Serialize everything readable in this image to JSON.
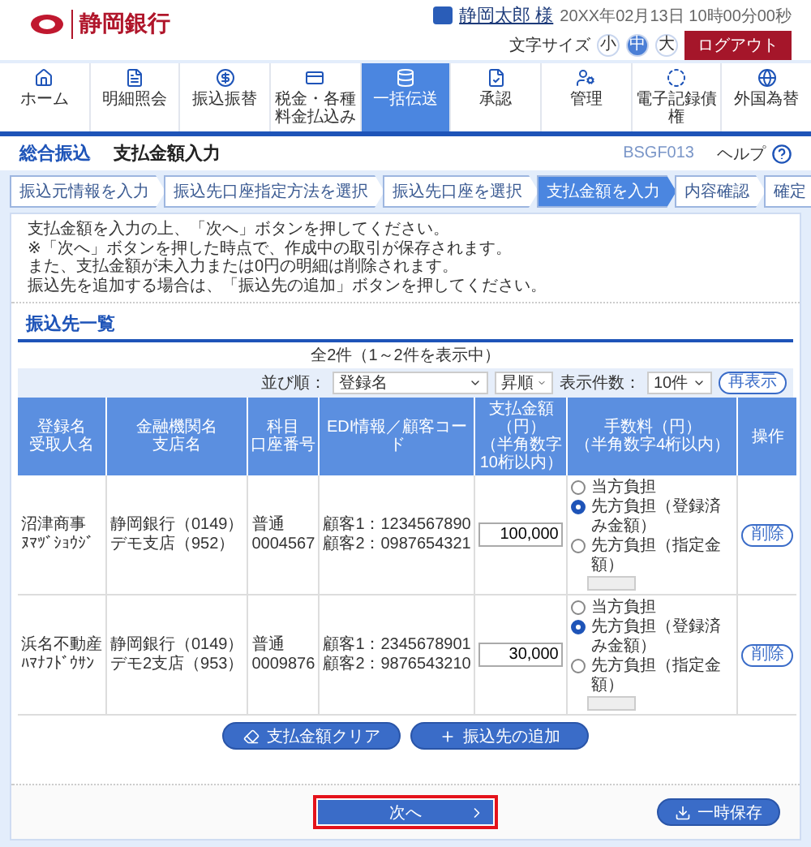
{
  "header": {
    "bank_name": "静岡銀行",
    "user_name": "静岡太郎 様",
    "datetime": "20XX年02月13日 10時00分00秒",
    "font_size_label": "文字サイズ",
    "font_sizes": [
      {
        "label": "小",
        "selected": false
      },
      {
        "label": "中",
        "selected": true
      },
      {
        "label": "大",
        "selected": false
      }
    ],
    "logout": "ログアウト"
  },
  "nav": [
    {
      "label": "ホーム",
      "selected": false
    },
    {
      "label": "明細照会",
      "selected": false
    },
    {
      "label": "振込振替",
      "selected": false
    },
    {
      "label": "税金・各種料金払込み",
      "selected": false
    },
    {
      "label": "一括伝送",
      "selected": true
    },
    {
      "label": "承認",
      "selected": false
    },
    {
      "label": "管理",
      "selected": false
    },
    {
      "label": "電子記録債権",
      "selected": false
    },
    {
      "label": "外国為替",
      "selected": false
    }
  ],
  "title_bar": {
    "category": "総合振込",
    "title": "支払金額入力",
    "screen_id": "BSGF013",
    "help": "ヘルプ"
  },
  "steps": [
    {
      "label": "振込元情報を入力",
      "selected": false
    },
    {
      "label": "振込先口座指定方法を選択",
      "selected": false
    },
    {
      "label": "振込先口座を選択",
      "selected": false
    },
    {
      "label": "支払金額を入力",
      "selected": true
    },
    {
      "label": "内容確認",
      "selected": false
    },
    {
      "label": "確定",
      "selected": false
    }
  ],
  "instructions": [
    "支払金額を入力の上、「次へ」ボタンを押してください。",
    "※「次へ」ボタンを押した時点で、作成中の取引が保存されます。",
    "また、支払金額が未入力または0円の明細は削除されます。",
    "振込先を追加する場合は、「振込先の追加」ボタンを押してください。"
  ],
  "section_title": "振込先一覧",
  "count": "全2件（1～2件を表示中）",
  "sort_bar": {
    "sort_label": "並び順：",
    "sort_value": "登録名",
    "order_value": "昇順",
    "per_page_label": "表示件数：",
    "per_page_value": "10件",
    "refresh": "再表示"
  },
  "columns": [
    [
      "登録名",
      "受取人名"
    ],
    [
      "金融機関名",
      "支店名"
    ],
    [
      "科目",
      "口座番号"
    ],
    [
      "EDI情報／顧客コード"
    ],
    [
      "支払金額（円）",
      "（半角数字10桁以内）"
    ],
    [
      "手数料（円）",
      "（半角数字4桁以内）"
    ],
    [
      "操作"
    ]
  ],
  "rows": [
    {
      "name": "沼津商事",
      "kana": "ﾇﾏﾂﾞｼｮｳｼﾞ",
      "bank": "静岡銀行（0149）",
      "branch": "デモ支店（952）",
      "type": "普通",
      "account": "0004567",
      "edi": [
        "顧客1：1234567890",
        "顧客2：0987654321"
      ],
      "amount": "100,000",
      "fee_options": [
        {
          "label": "当方負担",
          "selected": false
        },
        {
          "label": "先方負担（登録済み金額）",
          "selected": true
        },
        {
          "label": "先方負担（指定金額）",
          "selected": false
        }
      ],
      "delete": "削除"
    },
    {
      "name": "浜名不動産",
      "kana": "ﾊﾏﾅﾌﾄﾞｳｻﾝ",
      "bank": "静岡銀行（0149）",
      "branch": "デモ2支店（953）",
      "type": "普通",
      "account": "0009876",
      "edi": [
        "顧客1：2345678901",
        "顧客2：9876543210"
      ],
      "amount": "30,000",
      "fee_options": [
        {
          "label": "当方負担",
          "selected": false
        },
        {
          "label": "先方負担（登録済み金額）",
          "selected": true
        },
        {
          "label": "先方負担（指定金額）",
          "selected": false
        }
      ],
      "delete": "削除"
    }
  ],
  "actions": [
    "支払金額クリア",
    "振込先の追加"
  ],
  "footer": {
    "next": "次へ",
    "next_highlighted": true,
    "save": "一時保存"
  }
}
